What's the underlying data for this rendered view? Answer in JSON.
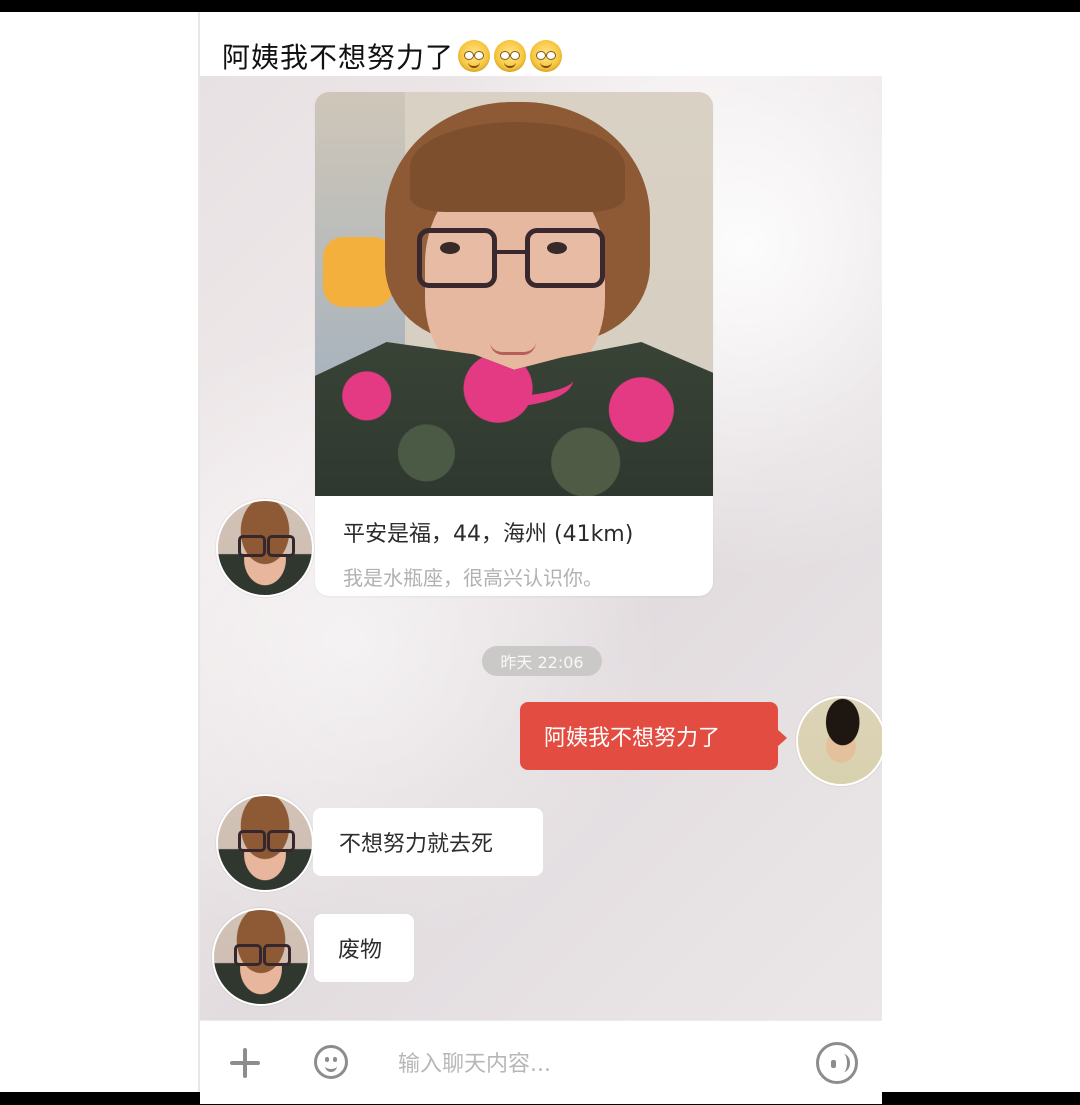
{
  "header": {
    "title": "阿姨我不想努力了",
    "emoji_icons": [
      "face-icon",
      "face-icon",
      "face-icon"
    ]
  },
  "chat": {
    "profile_card": {
      "name_line": "平安是福，44，海州 (41km)",
      "bio": "我是水瓶座，很高兴认识你。"
    },
    "timestamp": "昨天 22:06",
    "messages": [
      {
        "side": "outgoing",
        "text": "阿姨我不想努力了"
      },
      {
        "side": "incoming",
        "text": "不想努力就去死"
      },
      {
        "side": "incoming",
        "text": "废物"
      }
    ]
  },
  "composer": {
    "placeholder": "输入聊天内容..."
  },
  "colors": {
    "outgoing_bubble": "#e24c41",
    "incoming_bubble": "#ffffff",
    "timestamp_pill": "#cbc8c8"
  }
}
